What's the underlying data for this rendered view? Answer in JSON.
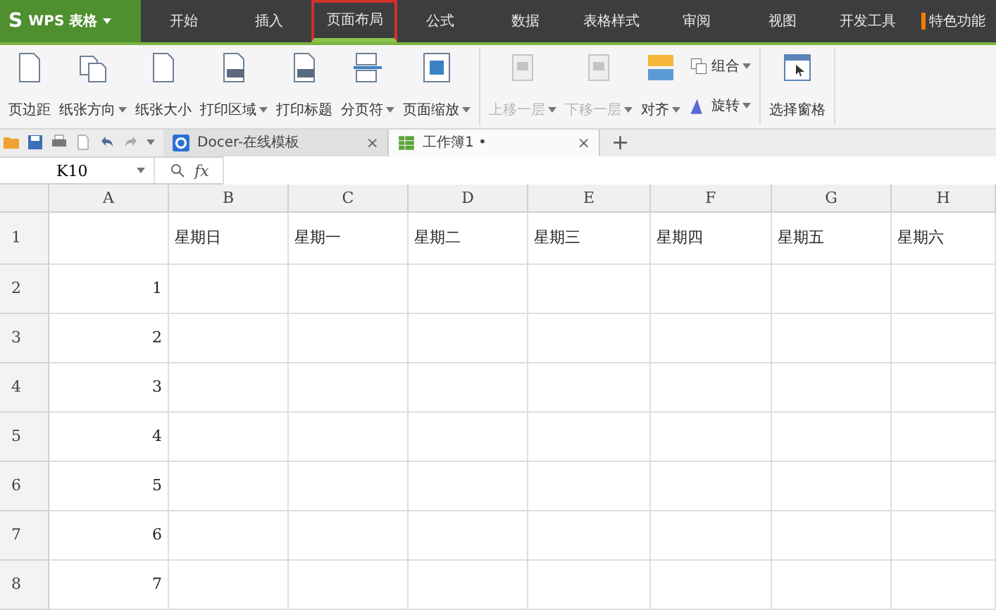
{
  "app_button": {
    "logo": "S",
    "label": "WPS 表格"
  },
  "menu_tabs": [
    {
      "label": "开始",
      "selected": false,
      "marked": false
    },
    {
      "label": "插入",
      "selected": false,
      "marked": false
    },
    {
      "label": "页面布局",
      "selected": true,
      "marked": false
    },
    {
      "label": "公式",
      "selected": false,
      "marked": false
    },
    {
      "label": "数据",
      "selected": false,
      "marked": false
    },
    {
      "label": "表格样式",
      "selected": false,
      "marked": false
    },
    {
      "label": "审阅",
      "selected": false,
      "marked": false
    },
    {
      "label": "视图",
      "selected": false,
      "marked": false
    },
    {
      "label": "开发工具",
      "selected": false,
      "marked": false
    },
    {
      "label": "特色功能",
      "selected": false,
      "marked": true
    }
  ],
  "ribbon_groups": [
    [
      {
        "kind": "large",
        "label": "页边距",
        "dropdown": false,
        "disabled": false
      },
      {
        "kind": "large",
        "label": "纸张方向",
        "dropdown": true,
        "disabled": false
      },
      {
        "kind": "large",
        "label": "纸张大小",
        "dropdown": false,
        "disabled": false
      },
      {
        "kind": "large",
        "label": "打印区域",
        "dropdown": true,
        "disabled": false
      },
      {
        "kind": "large",
        "label": "打印标题",
        "dropdown": false,
        "disabled": false
      },
      {
        "kind": "large",
        "label": "分页符",
        "dropdown": true,
        "disabled": false
      },
      {
        "kind": "large",
        "label": "页面缩放",
        "dropdown": true,
        "disabled": false
      }
    ],
    [
      {
        "kind": "large",
        "label": "上移一层",
        "dropdown": true,
        "disabled": true
      },
      {
        "kind": "large",
        "label": "下移一层",
        "dropdown": true,
        "disabled": true
      },
      {
        "kind": "large",
        "label": "对齐",
        "dropdown": true,
        "disabled": false
      },
      {
        "kind": "stack",
        "items": [
          {
            "label": "组合",
            "dropdown": true
          },
          {
            "label": "旋转",
            "dropdown": true
          }
        ]
      }
    ],
    [
      {
        "kind": "large",
        "label": "选择窗格",
        "dropdown": false,
        "disabled": false
      }
    ]
  ],
  "doc_tabs": [
    {
      "label": "Docer-在线模板",
      "selected": false,
      "close": "×"
    },
    {
      "label": "工作簿1 •",
      "selected": true,
      "close": "×"
    }
  ],
  "new_tab": "+",
  "formula_bar": {
    "cell_ref": "K10",
    "fx": "fx"
  },
  "sheet": {
    "columns": [
      "A",
      "B",
      "C",
      "D",
      "E",
      "F",
      "G",
      "H"
    ],
    "rows": [
      {
        "number": "1",
        "cells": {
          "B": "星期日",
          "C": "星期一",
          "D": "星期二",
          "E": "星期三",
          "F": "星期四",
          "G": "星期五",
          "H": "星期六"
        }
      },
      {
        "number": "2",
        "cells": {
          "A": "1"
        }
      },
      {
        "number": "3",
        "cells": {
          "A": "2"
        }
      },
      {
        "number": "4",
        "cells": {
          "A": "3"
        }
      },
      {
        "number": "5",
        "cells": {
          "A": "4"
        }
      },
      {
        "number": "6",
        "cells": {
          "A": "5"
        }
      },
      {
        "number": "7",
        "cells": {
          "A": "6"
        }
      },
      {
        "number": "8",
        "cells": {
          "A": "7"
        }
      }
    ]
  }
}
